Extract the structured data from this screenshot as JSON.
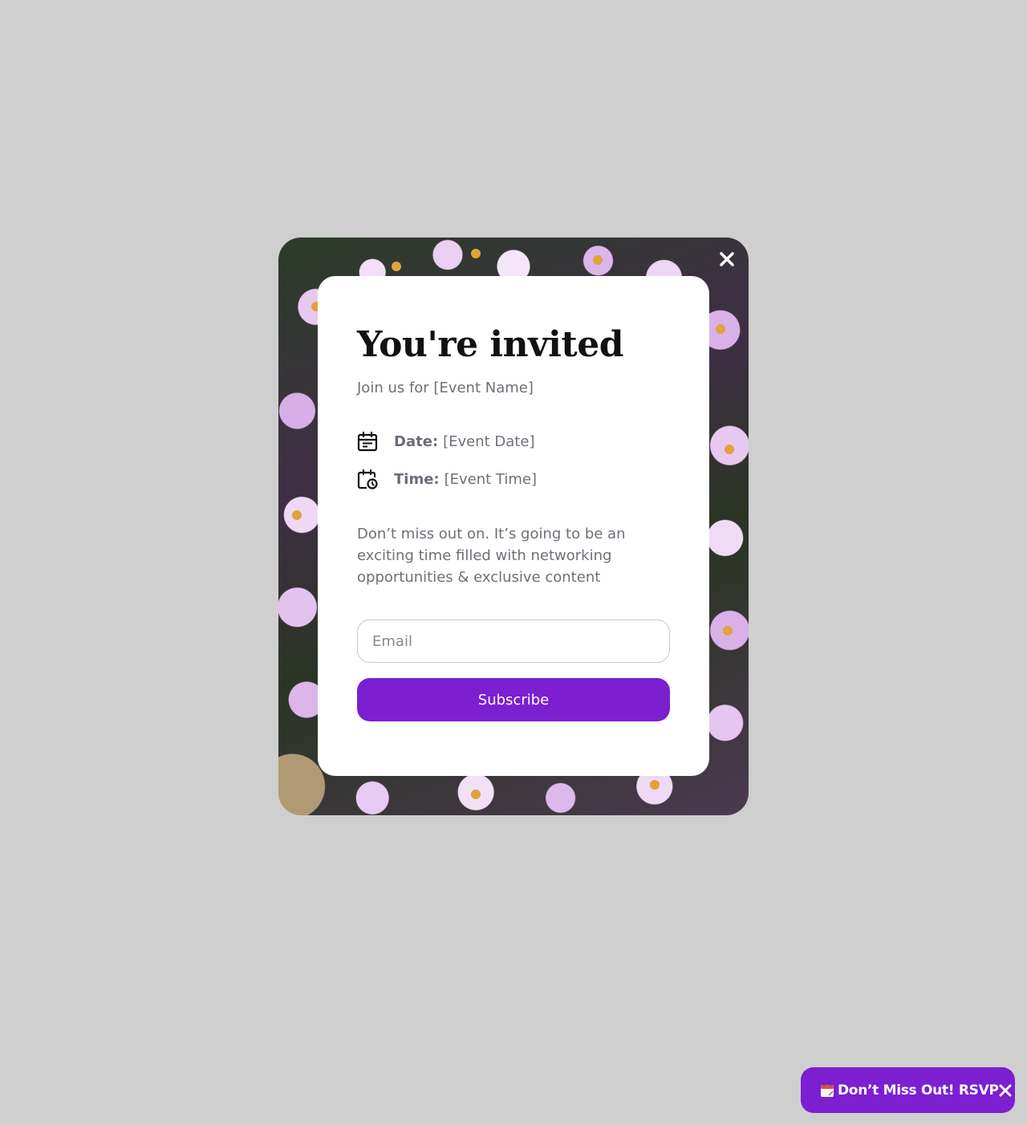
{
  "popup": {
    "title": "You're invited",
    "subtitle": "Join us for [Event Name]",
    "date_label": "Date:",
    "date_value": "[Event Date]",
    "time_label": "Time:",
    "time_value": "[Event Time]",
    "description": "Don’t miss out on. It’s going to be an exciting time filled with networking opportunities & exclusive content",
    "email_placeholder": "Email",
    "subscribe_label": "Subscribe",
    "close_icon": "close-icon"
  },
  "rsvp_pill": {
    "label": "Don’t Miss Out! RSVP",
    "emoji_icon": "calendar-emoji-icon",
    "close_icon": "close-icon"
  },
  "colors": {
    "accent": "#7b1fd1",
    "page_background": "#cfcfcf",
    "card_background": "#ffffff",
    "text_muted": "#6f6f78",
    "title_text": "#111111"
  }
}
